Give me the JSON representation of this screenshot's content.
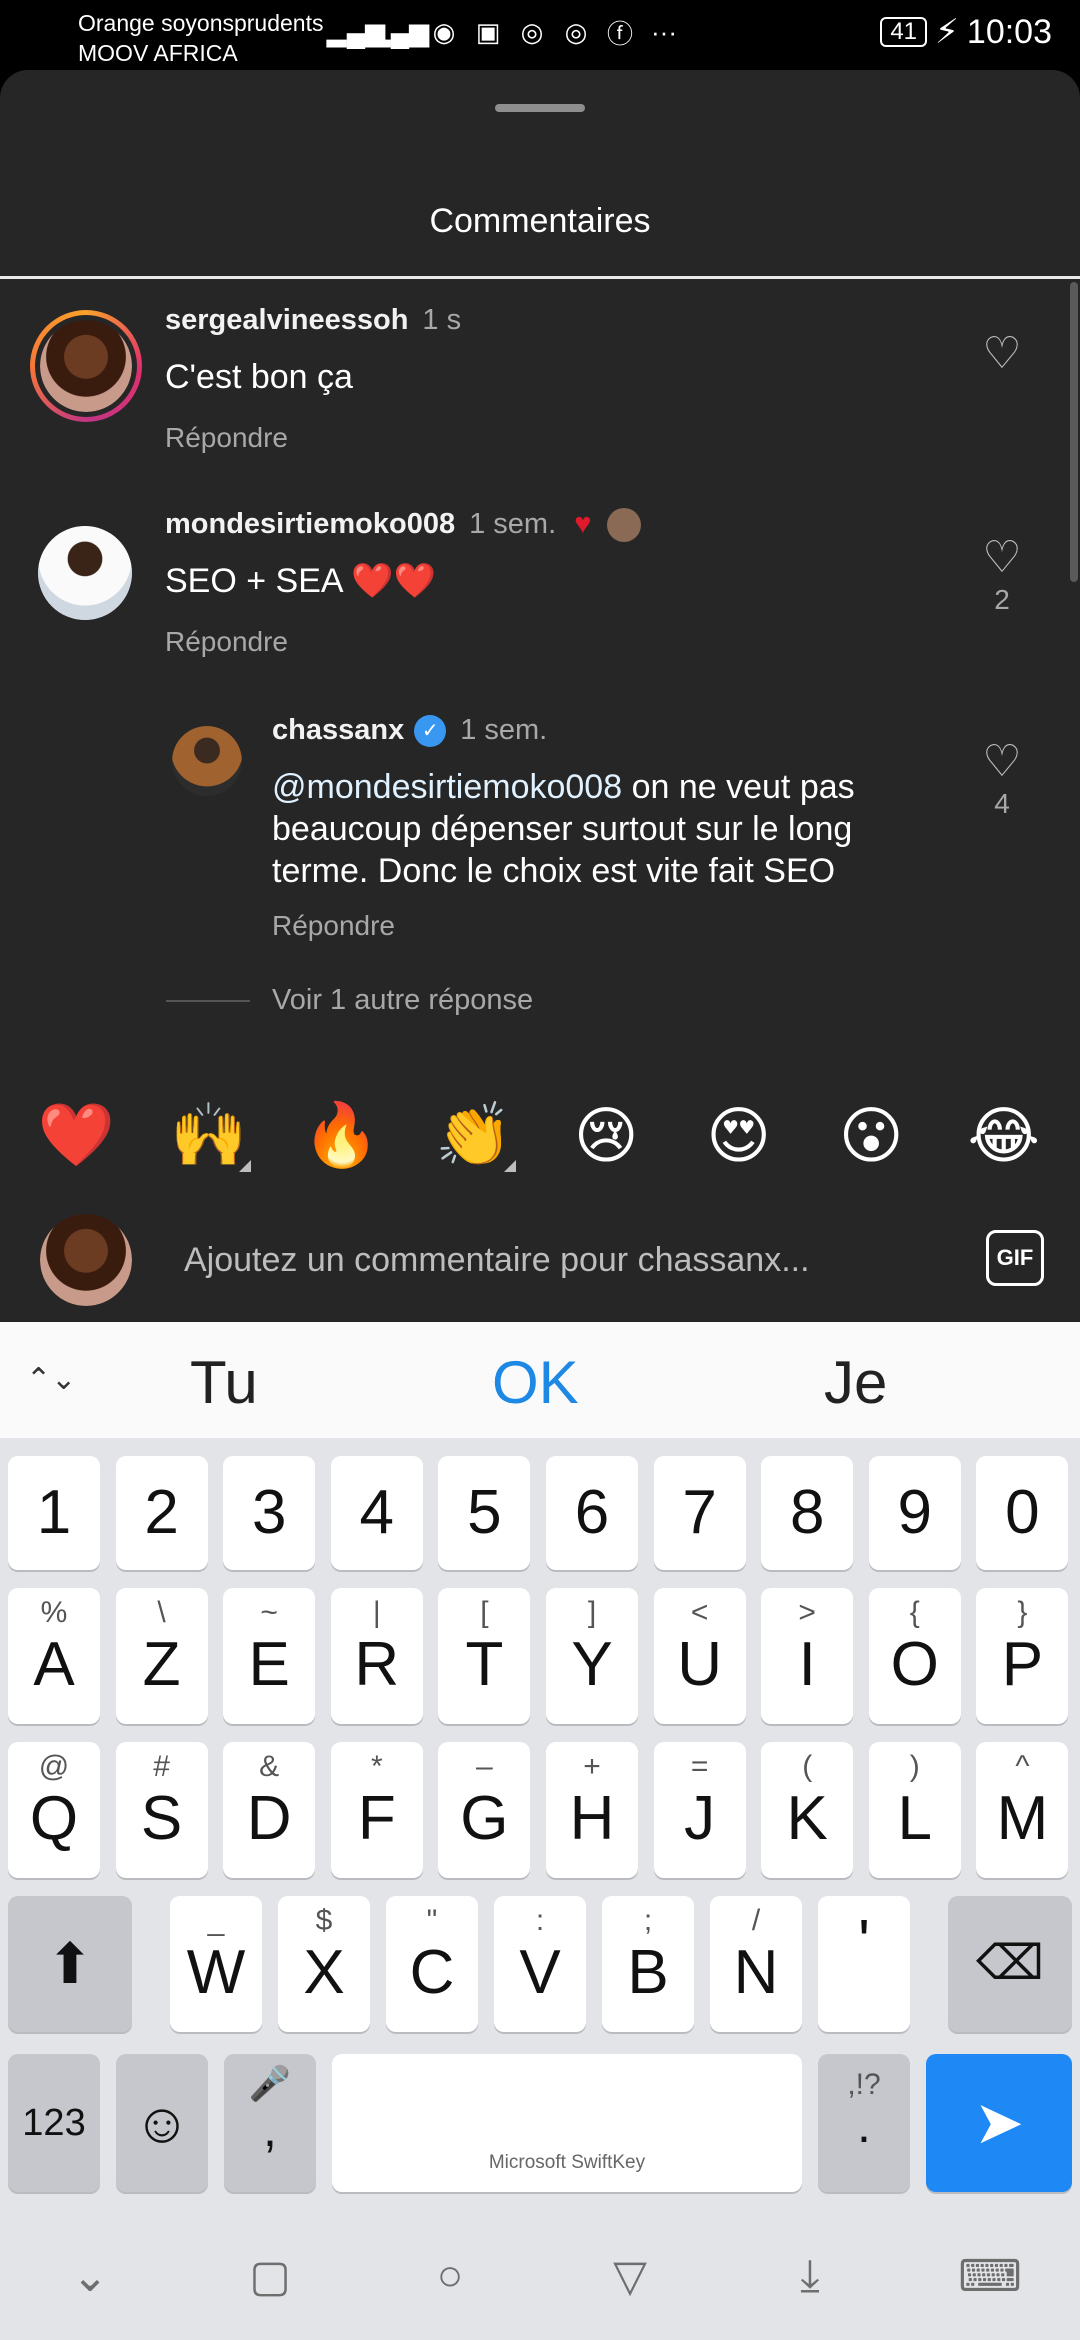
{
  "status_bar": {
    "carrier_line1": "Orange soyonsprudents",
    "carrier_line2": "MOOV AFRICA",
    "battery": "41",
    "time": "10:03",
    "more": "···"
  },
  "sheet": {
    "title": "Commentaires"
  },
  "comments": [
    {
      "username": "sergealvineessoh",
      "time": "1 s",
      "text": "C'est bon ça",
      "reply_label": "Répondre"
    },
    {
      "username": "mondesirtiemoko008",
      "time": "1 sem.",
      "text": "SEO + SEA ❤️❤️",
      "reply_label": "Répondre",
      "likes": "2"
    }
  ],
  "reply": {
    "username": "chassanx",
    "time": "1 sem.",
    "mention": "@mondesirtiemoko008",
    "text": " on ne veut pas beaucoup dépenser surtout sur le long terme. Donc le choix est vite fait SEO",
    "reply_label": "Répondre",
    "likes": "4"
  },
  "more_replies": "Voir 1 autre réponse",
  "emojis": [
    "❤️",
    "🙌",
    "🔥",
    "👏",
    "😢",
    "😍",
    "😮",
    "😂"
  ],
  "composer": {
    "placeholder": "Ajoutez un commentaire pour chassanx...",
    "gif_label": "GIF"
  },
  "keyboard": {
    "suggestions": [
      "Tu",
      "OK",
      "Je"
    ],
    "row_numbers": [
      "1",
      "2",
      "3",
      "4",
      "5",
      "6",
      "7",
      "8",
      "9",
      "0"
    ],
    "row1": [
      [
        "%",
        "A"
      ],
      [
        "\\",
        "Z"
      ],
      [
        "~",
        "E"
      ],
      [
        "|",
        "R"
      ],
      [
        "[",
        "T"
      ],
      [
        "]",
        "Y"
      ],
      [
        "<",
        "U"
      ],
      [
        ">",
        "I"
      ],
      [
        "{",
        "O"
      ],
      [
        "}",
        "P"
      ]
    ],
    "row2": [
      [
        "@",
        "Q"
      ],
      [
        "#",
        "S"
      ],
      [
        "&",
        "D"
      ],
      [
        "*",
        "F"
      ],
      [
        "–",
        "G"
      ],
      [
        "+",
        "H"
      ],
      [
        "=",
        "J"
      ],
      [
        "(",
        "K"
      ],
      [
        ")",
        "L"
      ],
      [
        "^",
        "M"
      ]
    ],
    "row3": [
      [
        "_",
        "W"
      ],
      [
        "$",
        "X"
      ],
      [
        "\"",
        "C"
      ],
      [
        ":",
        "V"
      ],
      [
        ";",
        "B"
      ],
      [
        "/",
        "N"
      ],
      [
        "",
        "'"
      ]
    ],
    "key_123": "123",
    "comma": ",",
    "period": ".",
    "punct_hint": ",!?",
    "brand": "Microsoft SwiftKey"
  },
  "colors": {
    "sheet_bg": "#262626",
    "accent": "#1e88f5",
    "heart": "#e0192b"
  }
}
